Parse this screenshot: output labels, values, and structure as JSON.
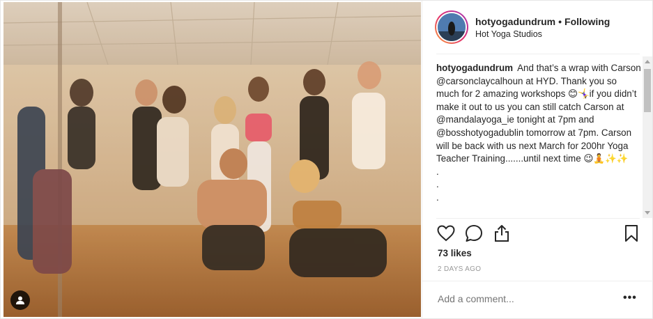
{
  "post": {
    "photo_alt": "Group of people posing in a yoga studio",
    "tag_icon": "person-tag-icon"
  },
  "header": {
    "username": "hotyogadundrum",
    "separator": "•",
    "follow_status": "Following",
    "location": "Hot Yoga Studios"
  },
  "caption": {
    "username": "hotyogadundrum",
    "text": "And that’s a wrap with Carson @carsonclaycalhoun at HYD. Thank you so much for 2 amazing workshops 😊🤸‍♀️if you didn’t make it out to us you can still catch Carson at @mandalayoga_ie tonight at 7pm and @bosshotyogadublin tomorrow at 7pm. Carson will be back with us next March for 200hr Yoga Teacher Training.......until next time 😉🧘✨✨",
    "dots": [
      ".",
      ".",
      "."
    ]
  },
  "actions": {
    "like_icon": "heart-icon",
    "comment_icon": "comment-icon",
    "share_icon": "share-icon",
    "save_icon": "bookmark-icon"
  },
  "likes": "73 likes",
  "timestamp": "2 DAYS AGO",
  "comment_box": {
    "placeholder": "Add a comment...",
    "more": "•••"
  }
}
